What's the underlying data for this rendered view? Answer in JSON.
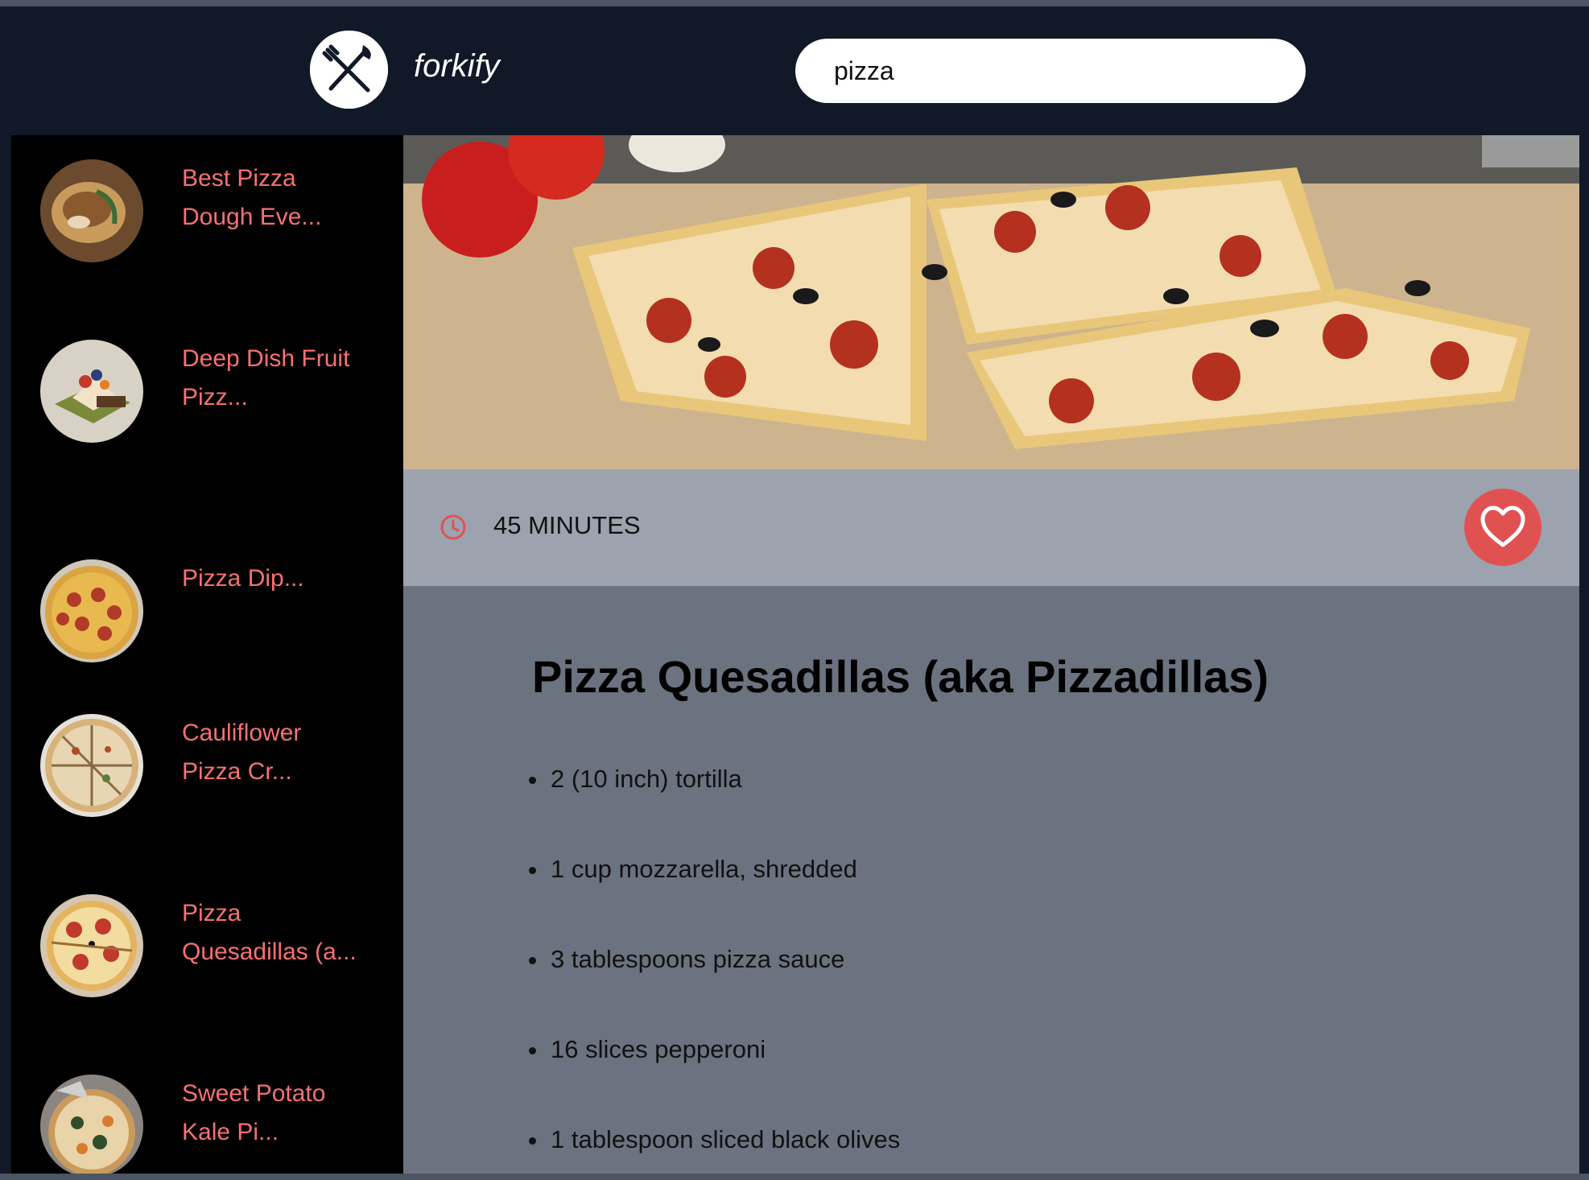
{
  "header": {
    "brand": "forkify",
    "search_value": "pizza"
  },
  "sidebar": {
    "results": [
      {
        "title_line1": "Best Pizza",
        "title_line2": "Dough Eve...",
        "thumb": "pizza-dough-icon"
      },
      {
        "title_line1": "Deep Dish Fruit",
        "title_line2": "Pizz...",
        "thumb": "fruit-pizza-icon"
      },
      {
        "title_line1": "Pizza Dip...",
        "title_line2": "",
        "thumb": "pizza-dip-icon"
      },
      {
        "title_line1": "Cauliflower",
        "title_line2": "Pizza Cr...",
        "thumb": "cauliflower-pizza-icon"
      },
      {
        "title_line1": "Pizza",
        "title_line2": "Quesadillas (a...",
        "thumb": "quesadilla-icon"
      },
      {
        "title_line1": "Sweet Potato",
        "title_line2": "Kale Pi...",
        "thumb": "sweet-potato-pizza-icon"
      }
    ]
  },
  "recipe": {
    "time": "45 MINUTES",
    "title": "Pizza Quesadillas (aka Pizzadillas)",
    "ingredients": [
      "2 (10 inch) tortilla",
      "1 cup mozzarella, shredded",
      "3 tablespoons pizza sauce",
      "16 slices pepperoni",
      "1 tablespoon sliced black olives"
    ]
  },
  "colors": {
    "header_bg": "#111827",
    "accent": "#f87171",
    "favorite": "#e05252",
    "info_bar": "#9ca3af",
    "content_bg": "#6b7280"
  }
}
